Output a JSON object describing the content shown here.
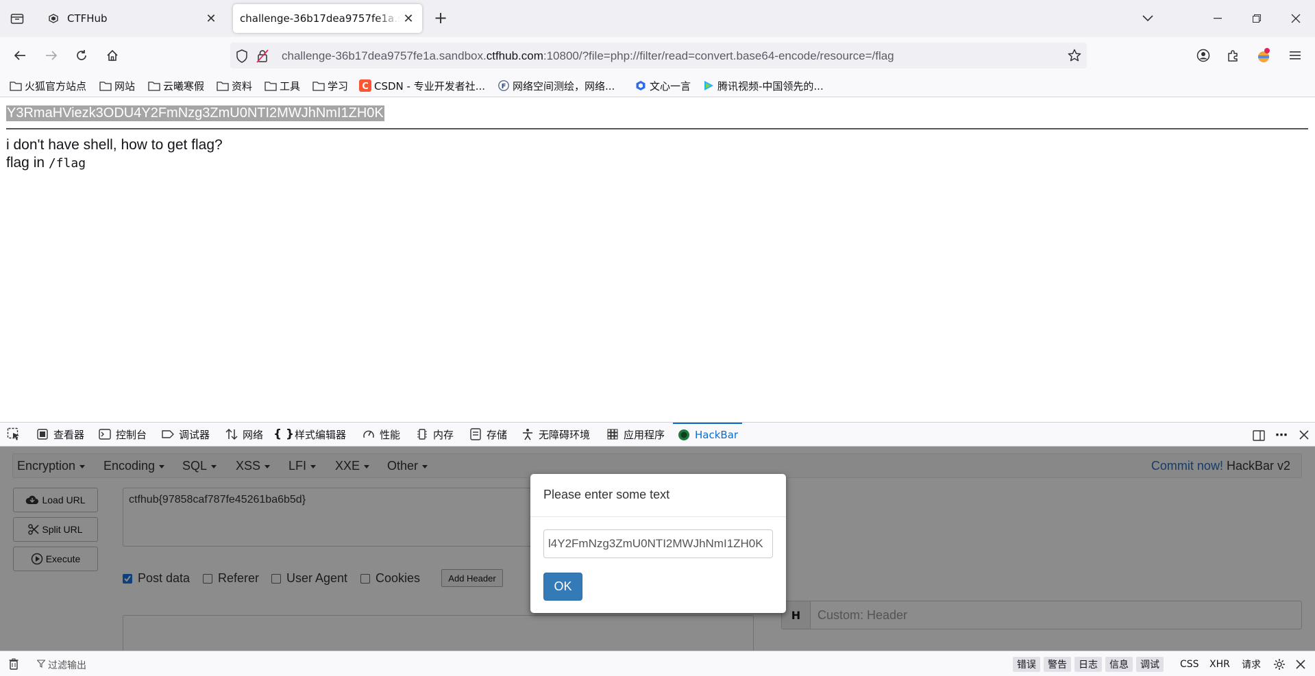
{
  "browser": {
    "tabs": [
      {
        "title": "CTFHub"
      },
      {
        "title": "challenge-36b17dea9757fe1a.sandbox.ctfhub.com"
      }
    ],
    "url": {
      "prefix": "challenge-36b17dea9757fe1a.sandbox.",
      "domain": "ctfhub.com",
      "suffix": ":10800/?file=php://filter/read=convert.base64-encode/resource=/flag"
    },
    "bookmarks": [
      {
        "label": "火狐官方站点",
        "icon": "folder-icon"
      },
      {
        "label": "网站",
        "icon": "folder-icon"
      },
      {
        "label": "云曦寒假",
        "icon": "folder-icon"
      },
      {
        "label": "资料",
        "icon": "folder-icon"
      },
      {
        "label": "工具",
        "icon": "folder-icon"
      },
      {
        "label": "学习",
        "icon": "folder-icon"
      },
      {
        "label": "CSDN - 专业开发者社...",
        "icon": "csdn-icon"
      },
      {
        "label": "网络空间测绘，网络...",
        "icon": "fofa-icon"
      },
      {
        "label": "文心一言",
        "icon": "wenxin-icon"
      },
      {
        "label": "腾讯视频-中国领先的...",
        "icon": "tencent-video-icon"
      }
    ]
  },
  "page": {
    "base64_output": "Y3RmaHViezk3ODU4Y2FmNzg3ZmU0NTI2MWJhNmI1ZH0K",
    "line1": "i don't have shell, how to get flag?",
    "line2_prefix": "flag in ",
    "line2_code": "/flag"
  },
  "devtools": {
    "tabs": [
      {
        "label": "查看器",
        "icon": "inspector-icon"
      },
      {
        "label": "控制台",
        "icon": "console-icon"
      },
      {
        "label": "调试器",
        "icon": "debugger-icon"
      },
      {
        "label": "网络",
        "icon": "network-icon"
      },
      {
        "label": "样式编辑器",
        "icon": "braces-icon"
      },
      {
        "label": "性能",
        "icon": "performance-icon"
      },
      {
        "label": "内存",
        "icon": "memory-icon"
      },
      {
        "label": "存储",
        "icon": "storage-icon"
      },
      {
        "label": "无障碍环境",
        "icon": "accessibility-icon"
      },
      {
        "label": "应用程序",
        "icon": "application-icon"
      },
      {
        "label": "HackBar",
        "icon": "hackbar-icon"
      }
    ]
  },
  "hackbar": {
    "menu": [
      "Encryption",
      "Encoding",
      "SQL",
      "XSS",
      "LFI",
      "XXE",
      "Other"
    ],
    "commit_link": "Commit now!",
    "commit_suffix": " HackBar v2",
    "buttons": {
      "load": "Load URL",
      "split": "Split URL",
      "execute": "Execute"
    },
    "url_value": "ctfhub{97858caf787fe45261ba6b5d}",
    "checkboxes": [
      {
        "label": "Post data",
        "checked": true
      },
      {
        "label": "Referer",
        "checked": false
      },
      {
        "label": "User Agent",
        "checked": false
      },
      {
        "label": "Cookies",
        "checked": false
      }
    ],
    "add_header": "Add Header",
    "header_letter": "H",
    "header_placeholder": "Custom: Header"
  },
  "dialog": {
    "title": "Please enter some text",
    "input_value": "l4Y2FmNzg3ZmU0NTI2MWJhNmI1ZH0K",
    "ok": "OK"
  },
  "console": {
    "filter": "过滤输出",
    "chips": [
      "错误",
      "警告",
      "日志",
      "信息",
      "调试"
    ],
    "plain": [
      "CSS",
      "XHR",
      "请求"
    ]
  },
  "colors": {
    "accent": "#0b6bd4",
    "ok_button": "#337ab7",
    "selection": "#a5a5a5"
  }
}
